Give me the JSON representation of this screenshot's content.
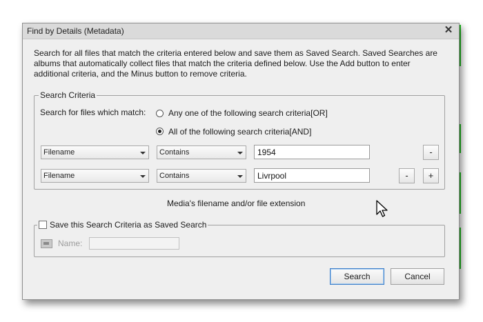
{
  "dialog": {
    "title": "Find by Details (Metadata)",
    "description": "Search for all files that match the criteria entered below and save them as Saved Search. Saved Searches are albums that automatically collect files that match the criteria defined below. Use the Add button to enter additional criteria, and the Minus button to remove criteria."
  },
  "search_criteria": {
    "legend": "Search Criteria",
    "match_label": "Search for files which match:",
    "options": [
      {
        "label": "Any one of the following search criteria[OR]",
        "selected": false
      },
      {
        "label": "All of the following search criteria[AND]",
        "selected": true
      }
    ],
    "rows": [
      {
        "field": "Filename",
        "operator": "Contains",
        "value": "1954",
        "minus": "-",
        "plus": ""
      },
      {
        "field": "Filename",
        "operator": "Contains",
        "value": "Livrpool",
        "minus": "-",
        "plus": "+"
      }
    ],
    "hint": "Media's filename and/or file extension"
  },
  "save": {
    "checkbox_label": "Save this Search Criteria as Saved Search",
    "checked": false,
    "name_label": "Name:",
    "name_value": ""
  },
  "buttons": {
    "search": "Search",
    "cancel": "Cancel"
  },
  "colors": {
    "dialog_bg": "#efefef",
    "titlebar_bg": "#dadada",
    "accent_green": "#22c022",
    "default_button_border": "#3b7dc8"
  }
}
